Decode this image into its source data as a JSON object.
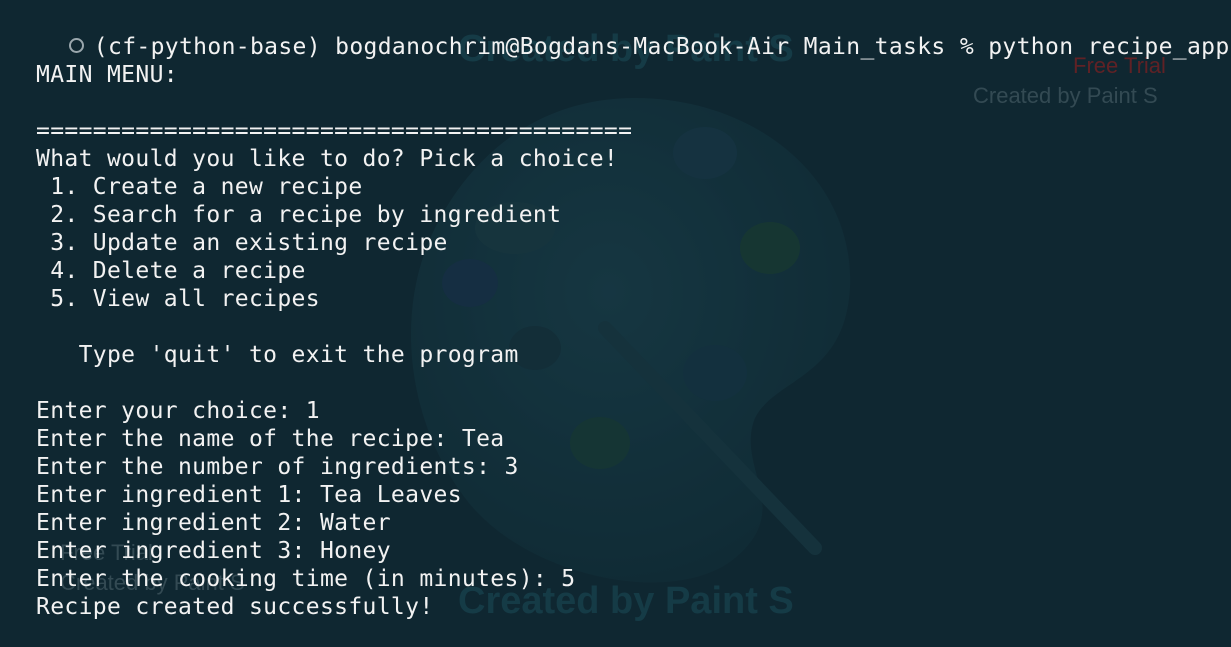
{
  "terminal": {
    "prompt": "(cf-python-base) bogdanochrim@Bogdans-MacBook-Air Main_tasks % python recipe_app.py",
    "lines": [
      "MAIN MENU:",
      "==========================================",
      "What would you like to do? Pick a choice!",
      " 1. Create a new recipe",
      " 2. Search for a recipe by ingredient",
      " 3. Update an existing recipe",
      " 4. Delete a recipe",
      " 5. View all recipes",
      "   Type 'quit' to exit the program",
      "Enter your choice: 1",
      "Enter the name of the recipe: Tea",
      "Enter the number of ingredients: 3",
      "Enter ingredient 1: Tea Leaves",
      "Enter ingredient 2: Water",
      "Enter ingredient 3: Honey",
      "Enter the cooking time (in minutes): 5",
      "Recipe created successfully!"
    ]
  },
  "watermark": {
    "top_text": "Created by Paint S",
    "free_trial": "Free Trial",
    "right_text": "Created by Paint S",
    "bottom_text": "Created by Paint S",
    "left_free_trial": "Free Trial",
    "left_text": "Created by Paint S"
  },
  "colors": {
    "background": "#0f2731",
    "text": "#f2f2f2",
    "watermark": "#163c48"
  },
  "icons": {
    "status": "circle-outline-icon",
    "watermark_logo": "paint-palette-icon"
  }
}
